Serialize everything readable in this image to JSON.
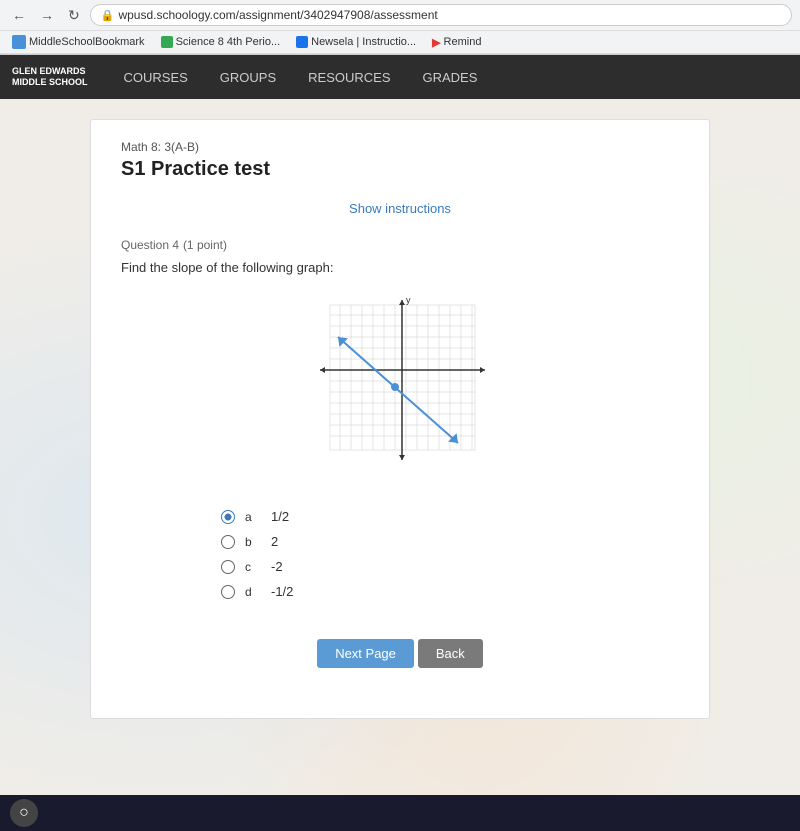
{
  "browser": {
    "url": "wpusd.schoology.com/assignment/3402947908/assessment",
    "nav_back": "←",
    "nav_forward": "→",
    "nav_refresh": "↻",
    "lock_icon": "🔒",
    "bookmarks": [
      {
        "label": "MiddleSchoolBookmark",
        "icon_color": "#4a90d9"
      },
      {
        "label": "Science 8 4th Perio...",
        "icon_color": "#34a853"
      },
      {
        "label": "Newsela | Instructio...",
        "icon_color": "#1a73e8"
      },
      {
        "label": "Remind",
        "icon_color": "#e53935"
      }
    ]
  },
  "schoology_nav": {
    "school_name_line1": "GLEN EDWARDS",
    "school_name_line2": "MIDDLE SCHOOL",
    "links": [
      "COURSES",
      "GROUPS",
      "RESOURCES",
      "GRADES"
    ]
  },
  "content": {
    "course_title": "Math 8: 3(A-B)",
    "page_title": "S1 Practice test",
    "show_instructions_label": "Show instructions",
    "question": {
      "number": "Question 4",
      "points": "(1 point)",
      "text": "Find the slope of the following graph:"
    },
    "answers": [
      {
        "id": "a",
        "label": "a",
        "value": "1/2",
        "selected": true
      },
      {
        "id": "b",
        "label": "b",
        "value": "2",
        "selected": false
      },
      {
        "id": "c",
        "label": "c",
        "value": "-2",
        "selected": false
      },
      {
        "id": "d",
        "label": "d",
        "value": "-1/2",
        "selected": false
      }
    ],
    "buttons": {
      "next": "Next Page",
      "back": "Back"
    }
  }
}
